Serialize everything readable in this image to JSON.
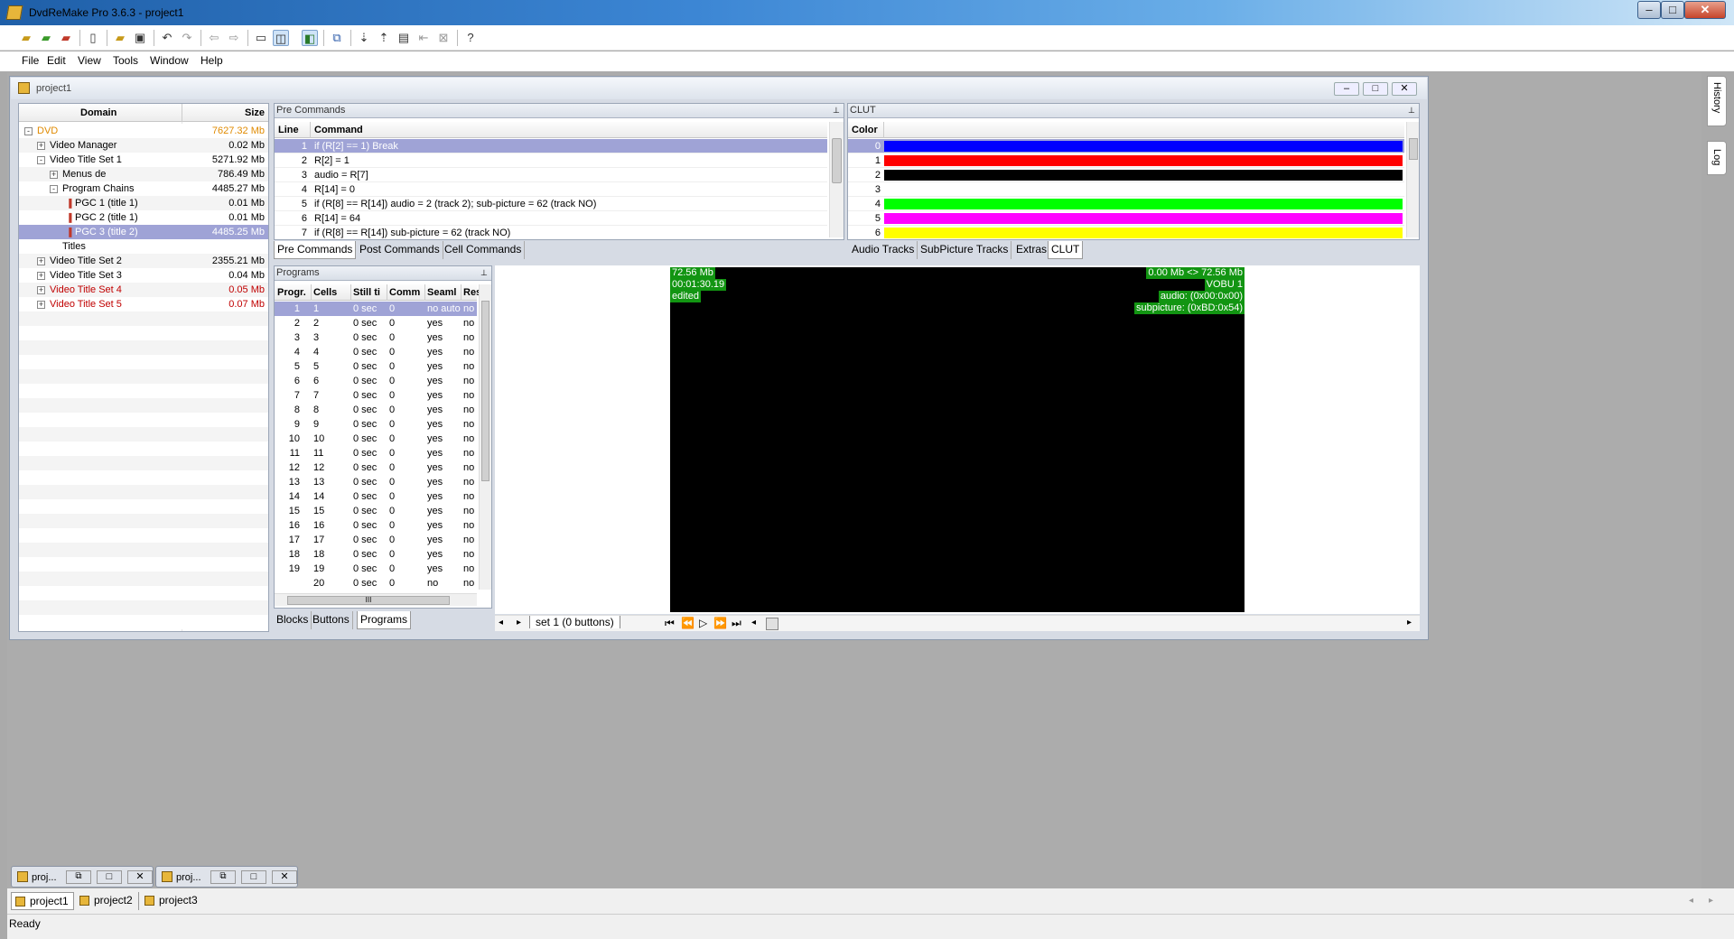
{
  "app": {
    "title": "DvdReMake Pro 3.6.3 - project1"
  },
  "menu": [
    "File",
    "Edit",
    "View",
    "Tools",
    "Window",
    "Help"
  ],
  "child": {
    "title": "project1"
  },
  "tree": {
    "col_domain": "Domain",
    "col_size": "Size",
    "items": [
      {
        "label": "DVD",
        "size": "7627.32 Mb",
        "indent": 0,
        "toggle": "-",
        "color": "#e08a00",
        "selected": false
      },
      {
        "label": "Video Manager",
        "size": "0.02 Mb",
        "indent": 1,
        "toggle": "+",
        "color": "#000",
        "selected": false
      },
      {
        "label": "Video Title Set 1",
        "size": "5271.92 Mb",
        "indent": 1,
        "toggle": "-",
        "color": "#000",
        "selected": false
      },
      {
        "label": "Menus de",
        "size": "786.49 Mb",
        "indent": 2,
        "toggle": "+",
        "color": "#000",
        "selected": false
      },
      {
        "label": "Program Chains",
        "size": "4485.27 Mb",
        "indent": 2,
        "toggle": "-",
        "color": "#000",
        "selected": false
      },
      {
        "label": "PGC 1  (title 1)",
        "size": "0.01 Mb",
        "indent": 3,
        "toggle": "",
        "color": "#000",
        "selected": false
      },
      {
        "label": "PGC 2  (title 1)",
        "size": "0.01 Mb",
        "indent": 3,
        "toggle": "",
        "color": "#000",
        "selected": false
      },
      {
        "label": "PGC 3  (title 2)",
        "size": "4485.25 Mb",
        "indent": 3,
        "toggle": "",
        "color": "#fff",
        "selected": true
      },
      {
        "label": "Titles",
        "size": "",
        "indent": 2,
        "toggle": "",
        "color": "#000",
        "selected": false
      },
      {
        "label": "Video Title Set 2",
        "size": "2355.21 Mb",
        "indent": 1,
        "toggle": "+",
        "color": "#000",
        "selected": false
      },
      {
        "label": "Video Title Set 3",
        "size": "0.04 Mb",
        "indent": 1,
        "toggle": "+",
        "color": "#000",
        "selected": false
      },
      {
        "label": "Video Title Set 4",
        "size": "0.05 Mb",
        "indent": 1,
        "toggle": "+",
        "color": "#c00000",
        "selected": false
      },
      {
        "label": "Video Title Set 5",
        "size": "0.07 Mb",
        "indent": 1,
        "toggle": "+",
        "color": "#c00000",
        "selected": false
      }
    ]
  },
  "precommands": {
    "header": "Pre Commands",
    "col_line": "Line",
    "col_command": "Command",
    "rows": [
      {
        "line": "1",
        "cmd": "if (R[2] == 1) Break"
      },
      {
        "line": "2",
        "cmd": "R[2] = 1"
      },
      {
        "line": "3",
        "cmd": "audio = R[7]"
      },
      {
        "line": "4",
        "cmd": "R[14] = 0"
      },
      {
        "line": "5",
        "cmd": "if (R[8] == R[14]) audio = 2 (track 2); sub-picture = 62 (track NO)"
      },
      {
        "line": "6",
        "cmd": "R[14] = 64"
      },
      {
        "line": "7",
        "cmd": "if (R[8] == R[14]) sub-picture = 62 (track NO)"
      }
    ],
    "tabs": [
      "Pre Commands",
      "Post Commands",
      "Cell Commands"
    ]
  },
  "clut": {
    "header": "CLUT",
    "col_color": "Color",
    "rows": [
      {
        "idx": "0",
        "color": "#0000ff"
      },
      {
        "idx": "1",
        "color": "#ff0000"
      },
      {
        "idx": "2",
        "color": "#000000"
      },
      {
        "idx": "3",
        "color": "#ffffff"
      },
      {
        "idx": "4",
        "color": "#00ff00"
      },
      {
        "idx": "5",
        "color": "#ff00ff"
      },
      {
        "idx": "6",
        "color": "#ffff00"
      }
    ],
    "tabs": [
      "Audio Tracks",
      "SubPicture Tracks",
      "Extras",
      "CLUT"
    ]
  },
  "programs": {
    "header": "Programs",
    "cols": [
      "Progr.",
      "Cells",
      "Still ti",
      "Comm",
      "Seaml",
      "Res"
    ],
    "rows": [
      [
        "1",
        "1",
        "0 sec",
        "0",
        "no auto",
        "no"
      ],
      [
        "2",
        "2",
        "0 sec",
        "0",
        "yes",
        "no"
      ],
      [
        "3",
        "3",
        "0 sec",
        "0",
        "yes",
        "no"
      ],
      [
        "4",
        "4",
        "0 sec",
        "0",
        "yes",
        "no"
      ],
      [
        "5",
        "5",
        "0 sec",
        "0",
        "yes",
        "no"
      ],
      [
        "6",
        "6",
        "0 sec",
        "0",
        "yes",
        "no"
      ],
      [
        "7",
        "7",
        "0 sec",
        "0",
        "yes",
        "no"
      ],
      [
        "8",
        "8",
        "0 sec",
        "0",
        "yes",
        "no"
      ],
      [
        "9",
        "9",
        "0 sec",
        "0",
        "yes",
        "no"
      ],
      [
        "10",
        "10",
        "0 sec",
        "0",
        "yes",
        "no"
      ],
      [
        "11",
        "11",
        "0 sec",
        "0",
        "yes",
        "no"
      ],
      [
        "12",
        "12",
        "0 sec",
        "0",
        "yes",
        "no"
      ],
      [
        "13",
        "13",
        "0 sec",
        "0",
        "yes",
        "no"
      ],
      [
        "14",
        "14",
        "0 sec",
        "0",
        "yes",
        "no"
      ],
      [
        "15",
        "15",
        "0 sec",
        "0",
        "yes",
        "no"
      ],
      [
        "16",
        "16",
        "0 sec",
        "0",
        "yes",
        "no"
      ],
      [
        "17",
        "17",
        "0 sec",
        "0",
        "yes",
        "no"
      ],
      [
        "18",
        "18",
        "0 sec",
        "0",
        "yes",
        "no"
      ],
      [
        "19",
        "19",
        "0 sec",
        "0",
        "yes",
        "no"
      ],
      [
        "",
        "20",
        "0 sec",
        "0",
        "no",
        "no"
      ]
    ],
    "tabs": [
      "Blocks",
      "Buttons",
      "Programs"
    ],
    "hscroll_glyph": "III"
  },
  "video": {
    "tl": [
      "72.56 Mb",
      "00:01:30.19",
      "edited"
    ],
    "tr": [
      "0.00 Mb <> 72.56 Mb",
      "VOBU 1",
      "audio: (0x00:0x00)",
      "subpicture: (0xBD:0x54)"
    ],
    "set_label": "set 1 (0 buttons)"
  },
  "side_tabs": [
    "History",
    "Log"
  ],
  "minimized": [
    {
      "label": "proj..."
    },
    {
      "label": "proj..."
    }
  ],
  "doc_tabs": [
    "project1",
    "project2",
    "project3"
  ],
  "status": "Ready",
  "win_controls": {
    "min": "–",
    "max": "□",
    "close": "✕"
  }
}
